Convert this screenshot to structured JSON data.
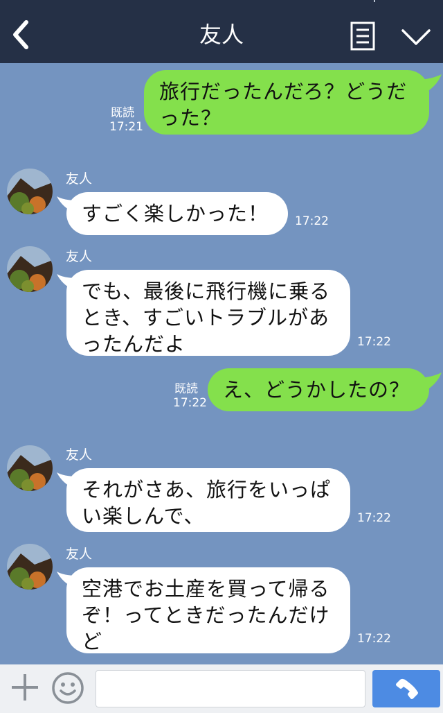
{
  "header": {
    "title": "友人",
    "back_icon": "chevron-left-icon",
    "menu_icon": "document-list-icon",
    "collapse_icon": "chevron-down-icon"
  },
  "messages": [
    {
      "direction": "out",
      "text": "旅行だったんだろ？どうだ\nった？",
      "read": "既読",
      "time": "17:21"
    },
    {
      "direction": "in",
      "sender": "友人",
      "text": "すごく楽しかった！",
      "time": "17:22"
    },
    {
      "direction": "in",
      "sender": "友人",
      "text": "でも、最後に飛行機に乗る\nとき、すごいトラブルがあ\nったんだよ",
      "time": "17:22"
    },
    {
      "direction": "out",
      "text": "え、どうかしたの？",
      "read": "既読",
      "time": "17:22"
    },
    {
      "direction": "in",
      "sender": "友人",
      "text": "それがさあ、旅行をいっぱ\nい楽しんで、",
      "time": "17:22"
    },
    {
      "direction": "in",
      "sender": "友人",
      "text": "空港でお土産を買って帰る\nぞ！ってときだったんだけ\nど",
      "time": "17:22"
    }
  ],
  "footer": {
    "plus_icon": "plus-icon",
    "emoji_icon": "smiley-icon",
    "input_value": "",
    "input_placeholder": "",
    "call_icon": "phone-icon"
  },
  "colors": {
    "header_bg": "#253046",
    "chat_bg": "#7494c0",
    "outgoing_bubble": "#84e04c",
    "incoming_bubble": "#ffffff",
    "call_button": "#4d8be3"
  }
}
